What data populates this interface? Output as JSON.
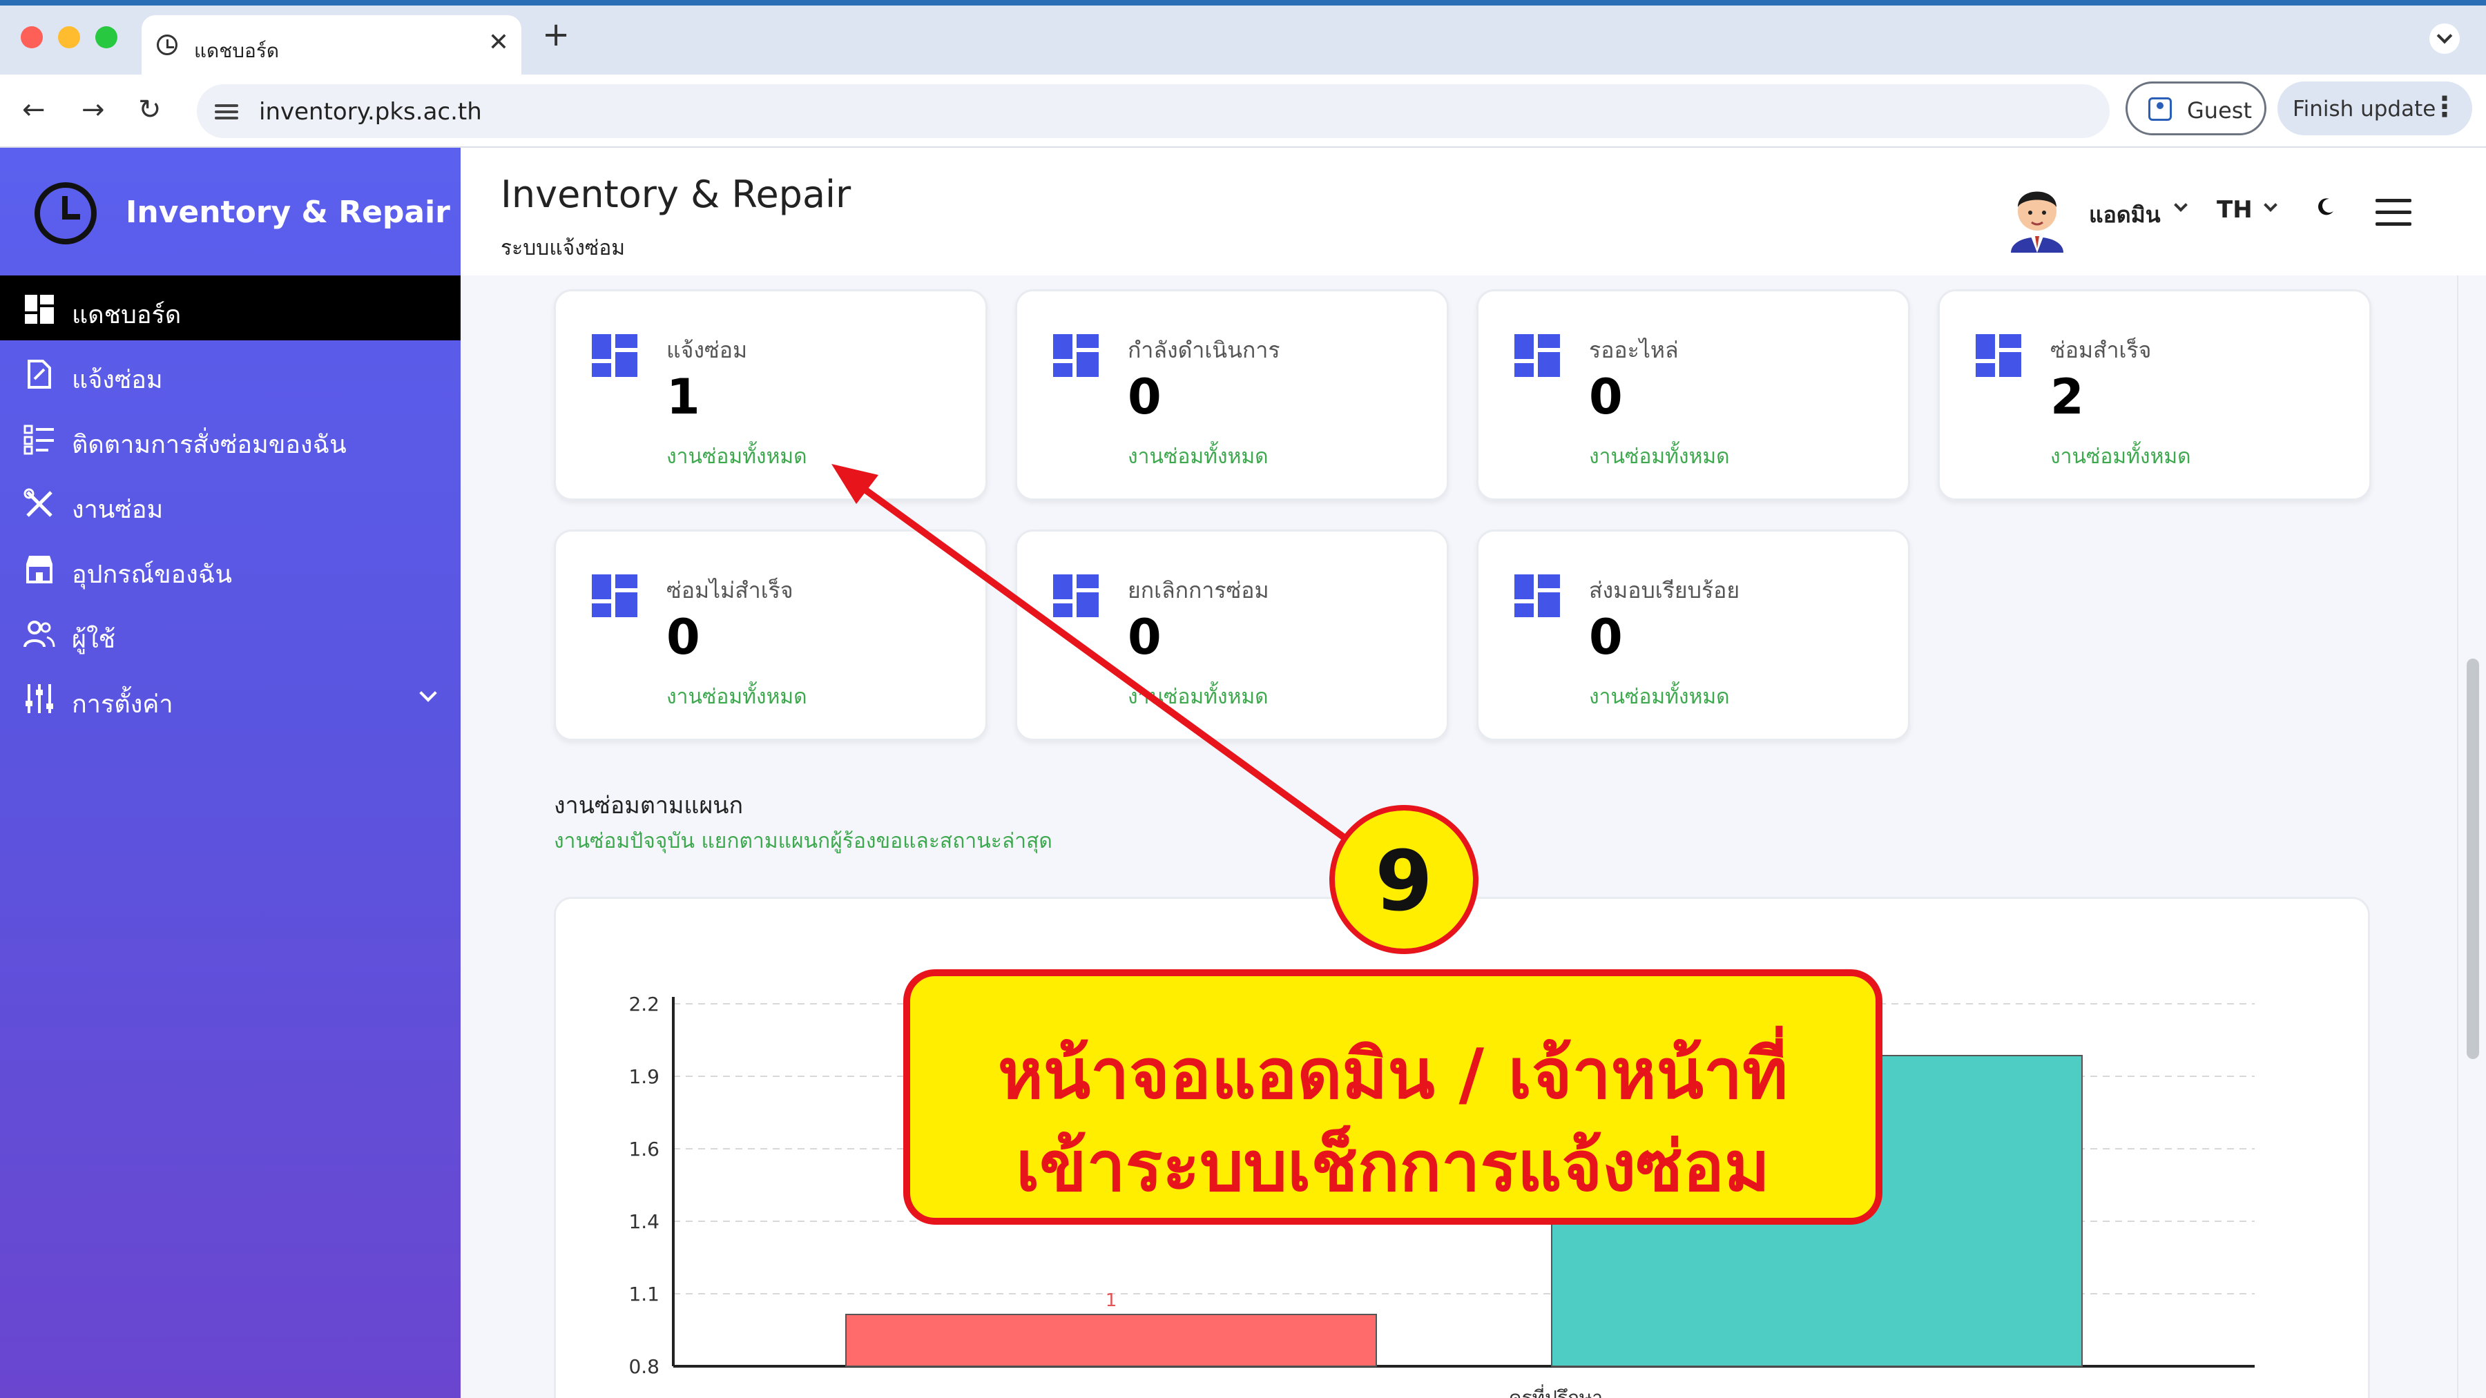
{
  "browser": {
    "tab_title": "แดชบอร์ด",
    "tab_close": "✕",
    "new_tab": "+",
    "url": "inventory.pks.ac.th",
    "guest_label": "Guest",
    "finish_update_label": "Finish update",
    "back": "←",
    "forward": "→",
    "reload": "↻",
    "menu_dots": "⋮"
  },
  "sidebar": {
    "brand": "Inventory & Repair",
    "items": [
      {
        "label": "แดชบอร์ด",
        "icon": "dashboard-icon",
        "active": true
      },
      {
        "label": "แจ้งซ่อม",
        "icon": "report-repair-icon",
        "active": false
      },
      {
        "label": "ติดตามการสั่งซ่อมของฉัน",
        "icon": "tracking-list-icon",
        "active": false
      },
      {
        "label": "งานซ่อม",
        "icon": "tools-icon",
        "active": false
      },
      {
        "label": "อุปกรณ์ของฉัน",
        "icon": "store-icon",
        "active": false
      },
      {
        "label": "ผู้ใช้",
        "icon": "users-icon",
        "active": false
      },
      {
        "label": "การตั้งค่า",
        "icon": "sliders-icon",
        "active": false
      }
    ]
  },
  "header": {
    "title": "Inventory & Repair",
    "subtitle": "ระบบแจ้งซ่อม",
    "user_name": "แอดมิน",
    "language": "TH"
  },
  "cards": [
    {
      "label": "แจ้งซ่อม",
      "value": "1",
      "sub": "งานซ่อมทั้งหมด"
    },
    {
      "label": "กำลังดำเนินการ",
      "value": "0",
      "sub": "งานซ่อมทั้งหมด"
    },
    {
      "label": "รออะไหล่",
      "value": "0",
      "sub": "งานซ่อมทั้งหมด"
    },
    {
      "label": "ซ่อมสำเร็จ",
      "value": "2",
      "sub": "งานซ่อมทั้งหมด"
    },
    {
      "label": "ซ่อมไม่สำเร็จ",
      "value": "0",
      "sub": "งานซ่อมทั้งหมด"
    },
    {
      "label": "ยกเลิกการซ่อม",
      "value": "0",
      "sub": "งานซ่อมทั้งหมด"
    },
    {
      "label": "ส่งมอบเรียบร้อย",
      "value": "0",
      "sub": "งานซ่อมทั้งหมด"
    }
  ],
  "section": {
    "title": "งานซ่อมตามแผนก",
    "subtitle": "งานซ่อมปัจจุบัน แยกตามแผนกผู้ร้องขอและสถานะล่าสุด"
  },
  "chart_data": {
    "type": "bar",
    "categories": [
      "ครูที่ปรึกษา"
    ],
    "series": [
      {
        "values": [
          1
        ],
        "color": "#ff6b6b",
        "label": "1"
      },
      {
        "values": [
          2
        ],
        "color": "#4ecdc4",
        "label": ""
      }
    ],
    "y_ticks": [
      "0.8",
      "1.1",
      "1.4",
      "1.6",
      "1.9",
      "2.2"
    ],
    "ylim": [
      0.8,
      2.2
    ],
    "grid": true
  },
  "annotation": {
    "badge_number": "9",
    "callout_line1": "หน้าจอแอดมิน / เจ้าหน้าที่",
    "callout_line2": "เข้าระบบเช็กการแจ้งซ่อม",
    "arrow_color": "#e8141c",
    "fill_color": "#ffee00"
  },
  "colors": {
    "card_icon": "#4355e8",
    "sub_text_green": "#3ea84e",
    "sidebar_active": "#000000"
  }
}
